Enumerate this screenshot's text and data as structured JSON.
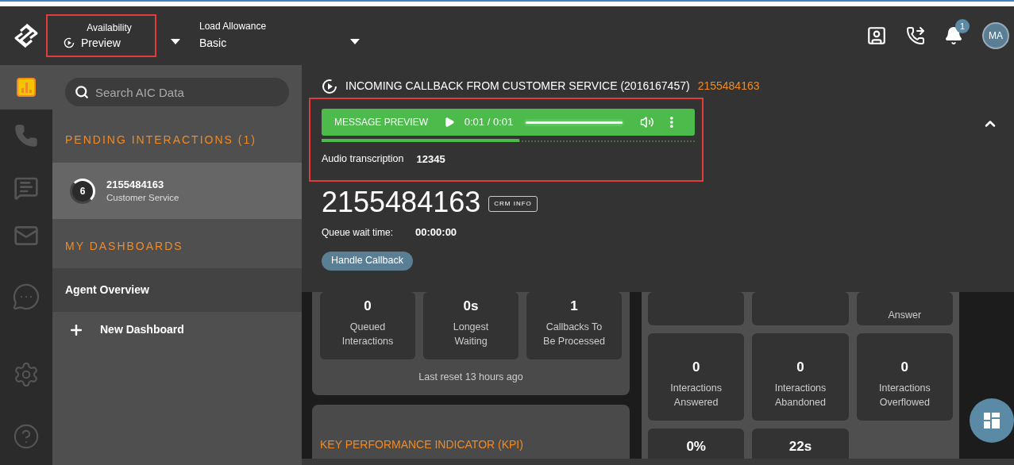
{
  "header": {
    "availability": {
      "label": "Availability",
      "value": "Preview"
    },
    "load_allowance": {
      "label": "Load Allowance",
      "value": "Basic"
    },
    "notification_badge": "1",
    "avatar": "MA"
  },
  "rail": [
    {
      "kind": "analytics",
      "selected": true
    },
    {
      "kind": "phone",
      "selected": false
    },
    {
      "kind": "chat",
      "selected": false
    },
    {
      "kind": "mail",
      "selected": false
    },
    {
      "kind": "messages",
      "selected": false
    },
    {
      "kind": "settings",
      "selected": false
    },
    {
      "kind": "help",
      "selected": false
    }
  ],
  "sidebar": {
    "search_placeholder": "Search AIC Data",
    "pending_title": "PENDING INTERACTIONS (1)",
    "pending": [
      {
        "number": "2155484163",
        "queue": "Customer Service",
        "timer": "6",
        "selected": true
      }
    ],
    "dashboards_title": "MY DASHBOARDS",
    "dashboards": [
      {
        "label": "Agent Overview",
        "selected": true
      }
    ],
    "new_dashboard": "New Dashboard"
  },
  "callback": {
    "title": "INCOMING CALLBACK FROM CUSTOMER SERVICE (2016167457)",
    "title_number": "2155484163",
    "player": {
      "label": "MESSAGE PREVIEW",
      "time": "0:01 / 0:01",
      "level": 1
    },
    "progress": {
      "level": 0.53
    },
    "transcription_label": "Audio transcription",
    "transcription_value": "12345",
    "number": "2155484163",
    "crm_button": "CRM INFO",
    "wait_label": "Queue wait time:",
    "wait_value": "00:00:00",
    "handle_button": "Handle Callback"
  },
  "dashboard": {
    "summary_tiles": [
      {
        "value": "0",
        "label": "Queued\nInteractions"
      },
      {
        "value": "0s",
        "label": "Longest\nWaiting"
      },
      {
        "value": "1",
        "label": "Callbacks To\nBe Processed"
      }
    ],
    "last_reset": "Last reset 13 hours ago",
    "kpi_title": "KEY PERFORMANCE INDICATOR (KPI)",
    "partial_tiles": [
      {
        "label": "Answer"
      }
    ],
    "right_tiles": [
      [
        {
          "value": "0",
          "label": "Interactions\nAnswered"
        },
        {
          "value": "0",
          "label": "Interactions\nAbandoned"
        },
        {
          "value": "0",
          "label": "Interactions\nOverflowed"
        }
      ],
      [
        {
          "value": "0%"
        },
        {
          "value": "22s"
        }
      ]
    ]
  }
}
